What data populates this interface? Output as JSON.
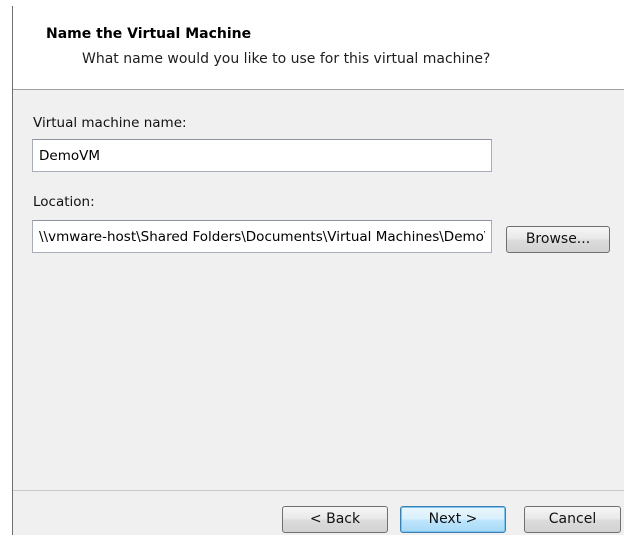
{
  "header": {
    "title": "Name the Virtual Machine",
    "subtitle": "What name would you like to use for this virtual machine?"
  },
  "form": {
    "vm_name": {
      "label": "Virtual machine name:",
      "value": "DemoVM"
    },
    "location": {
      "label": "Location:",
      "value": "\\\\vmware-host\\Shared Folders\\Documents\\Virtual Machines\\DemoVM",
      "browse_label": "Browse..."
    }
  },
  "footer": {
    "back_label": "< Back",
    "next_label": "Next >",
    "cancel_label": "Cancel"
  }
}
